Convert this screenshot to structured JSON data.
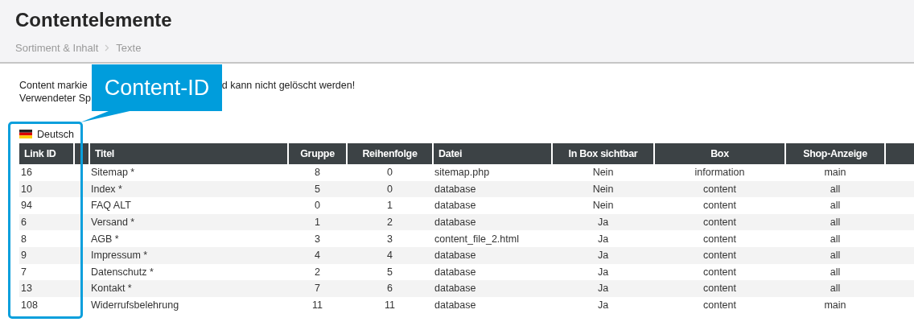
{
  "page_title": "Contentelemente",
  "breadcrumb": [
    {
      "label": "Sortiment & Inhalt"
    },
    {
      "label": "Texte"
    }
  ],
  "notice": {
    "line_1_start": "Content markie",
    "line_1_end": "d kann nicht gelöscht werden!",
    "line_2_start": "Verwendeter Sp"
  },
  "callout": {
    "label": "Content-ID"
  },
  "language": {
    "label": "Deutsch"
  },
  "table": {
    "columns": [
      {
        "kind": "text",
        "label": "Link ID"
      },
      {
        "kind": "blank"
      },
      {
        "kind": "text",
        "label": "Titel"
      },
      {
        "kind": "text",
        "label": "Gruppe"
      },
      {
        "kind": "text",
        "label": "Reihenfolge"
      },
      {
        "kind": "text",
        "label": "Datei"
      },
      {
        "kind": "text",
        "label": "In Box sichtbar"
      },
      {
        "kind": "text",
        "label": "Box"
      },
      {
        "kind": "text",
        "label": "Shop-Anzeige"
      },
      {
        "kind": "blank"
      }
    ],
    "rows": [
      {
        "cells": [
          "16",
          "",
          "Sitemap *",
          "8",
          "0",
          "sitemap.php",
          "Nein",
          "information",
          "main",
          ""
        ]
      },
      {
        "cells": [
          "10",
          "",
          "Index *",
          "5",
          "0",
          "database",
          "Nein",
          "content",
          "all",
          ""
        ]
      },
      {
        "cells": [
          "94",
          "",
          "FAQ ALT",
          "0",
          "1",
          "database",
          "Nein",
          "content",
          "all",
          ""
        ]
      },
      {
        "cells": [
          "6",
          "",
          "Versand *",
          "1",
          "2",
          "database",
          "Ja",
          "content",
          "all",
          ""
        ]
      },
      {
        "cells": [
          "8",
          "",
          "AGB *",
          "3",
          "3",
          "content_file_2.html",
          "Ja",
          "content",
          "all",
          ""
        ]
      },
      {
        "cells": [
          "9",
          "",
          "Impressum *",
          "4",
          "4",
          "database",
          "Ja",
          "content",
          "all",
          ""
        ]
      },
      {
        "cells": [
          "7",
          "",
          "Datenschutz *",
          "2",
          "5",
          "database",
          "Ja",
          "content",
          "all",
          ""
        ]
      },
      {
        "cells": [
          "13",
          "",
          "Kontakt *",
          "7",
          "6",
          "database",
          "Ja",
          "content",
          "all",
          ""
        ]
      },
      {
        "cells": [
          "108",
          "",
          "Widerrufsbelehrung",
          "11",
          "11",
          "database",
          "Ja",
          "content",
          "main",
          ""
        ]
      }
    ]
  }
}
